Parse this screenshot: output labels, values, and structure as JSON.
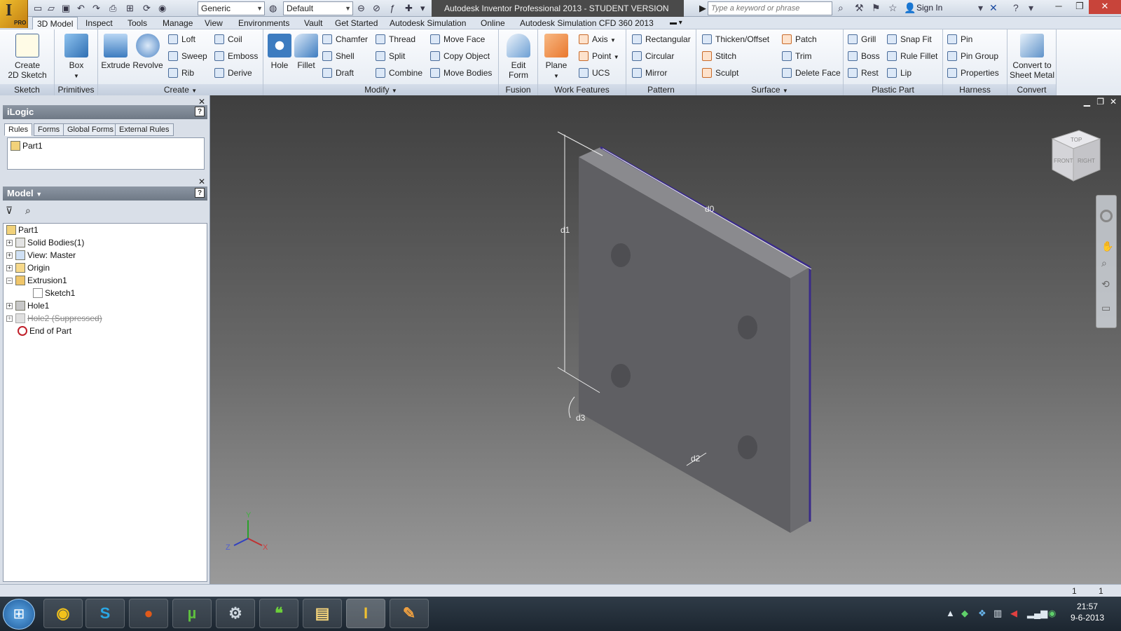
{
  "app": {
    "window_title": "Autodesk Inventor Professional 2013 - STUDENT VERSION    Part1",
    "logo_letter": "I",
    "edition": "PRO"
  },
  "quick_access": {
    "material": "Generic",
    "appearance": "Default",
    "search_placeholder": "Type a keyword or phrase",
    "sign_in": "Sign In"
  },
  "menu_tabs": [
    "3D Model",
    "Inspect",
    "Tools",
    "Manage",
    "View",
    "Environments",
    "Vault",
    "Get Started",
    "Autodesk Simulation",
    "Online",
    "Autodesk Simulation CFD 360 2013"
  ],
  "ribbon": {
    "sketch": {
      "label": "Sketch",
      "create_2d": "Create\n2D Sketch"
    },
    "primitives": {
      "label": "Primitives",
      "box": "Box"
    },
    "create": {
      "label": "Create",
      "extrude": "Extrude",
      "revolve": "Revolve",
      "loft": "Loft",
      "sweep": "Sweep",
      "rib": "Rib",
      "coil": "Coil",
      "emboss": "Emboss",
      "derive": "Derive"
    },
    "modify": {
      "label": "Modify",
      "hole": "Hole",
      "fillet": "Fillet",
      "chamfer": "Chamfer",
      "shell": "Shell",
      "draft": "Draft",
      "thread": "Thread",
      "split": "Split",
      "combine": "Combine",
      "move_face": "Move Face",
      "copy_object": "Copy Object",
      "move_bodies": "Move Bodies"
    },
    "fusion": {
      "label": "Fusion",
      "edit_form": "Edit\nForm"
    },
    "work_features": {
      "label": "Work Features",
      "plane": "Plane",
      "axis": "Axis",
      "point": "Point",
      "ucs": "UCS"
    },
    "pattern": {
      "label": "Pattern",
      "rectangular": "Rectangular",
      "circular": "Circular",
      "mirror": "Mirror"
    },
    "surface": {
      "label": "Surface",
      "thicken": "Thicken/Offset",
      "stitch": "Stitch",
      "sculpt": "Sculpt",
      "patch": "Patch",
      "trim": "Trim",
      "delete_face": "Delete Face"
    },
    "plastic_part": {
      "label": "Plastic Part",
      "grill": "Grill",
      "boss": "Boss",
      "rest": "Rest",
      "snap_fit": "Snap Fit",
      "rule_fillet": "Rule Fillet",
      "lip": "Lip"
    },
    "harness": {
      "label": "Harness",
      "pin": "Pin",
      "pin_group": "Pin Group",
      "properties": "Properties"
    },
    "convert": {
      "label": "Convert",
      "sheet_metal": "Convert to\nSheet Metal"
    }
  },
  "ilogic": {
    "title": "iLogic",
    "tabs": [
      "Rules",
      "Forms",
      "Global Forms",
      "External Rules"
    ],
    "rule_item": "Part1"
  },
  "model": {
    "title": "Model",
    "tree": [
      {
        "label": "Part1"
      },
      {
        "label": "Solid Bodies(1)"
      },
      {
        "label": "View: Master"
      },
      {
        "label": "Origin"
      },
      {
        "label": "Extrusion1"
      },
      {
        "label": "Sketch1"
      },
      {
        "label": "Hole1"
      },
      {
        "label": "Hole2 (Suppressed)"
      },
      {
        "label": "End of Part"
      }
    ]
  },
  "viewport": {
    "dims": [
      "d0",
      "d1",
      "d2",
      "d3"
    ],
    "viewcube_faces": [
      "TOP",
      "FRONT",
      "RIGHT"
    ],
    "axes": [
      "X",
      "Y",
      "Z"
    ]
  },
  "status": {
    "left_count": "1",
    "right_count": "1"
  },
  "taskbar": {
    "time": "21:57",
    "date": "9-6-2013"
  },
  "colors": {
    "accent": "#2b5797",
    "part_face": "#5a5a5e",
    "edge_highlight": "#3a2b8a"
  }
}
